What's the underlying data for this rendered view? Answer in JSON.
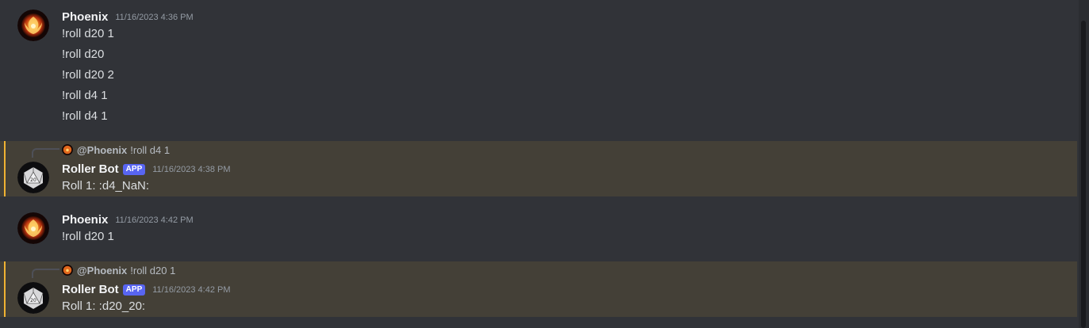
{
  "messages": [
    {
      "author": "Phoenix",
      "timestamp": "11/16/2023 4:36 PM",
      "lines": [
        "!roll d20 1",
        "!roll d20",
        "!roll d20 2",
        "!roll d4 1",
        "!roll d4 1"
      ]
    },
    {
      "reply": {
        "author": "@Phoenix",
        "text": "!roll d4 1"
      },
      "author": "Roller Bot",
      "badge": "APP",
      "timestamp": "11/16/2023 4:38 PM",
      "lines": [
        "Roll 1: :d4_NaN:"
      ]
    },
    {
      "author": "Phoenix",
      "timestamp": "11/16/2023 4:42 PM",
      "lines": [
        "!roll d20 1"
      ]
    },
    {
      "reply": {
        "author": "@Phoenix",
        "text": "!roll d20 1"
      },
      "author": "Roller Bot",
      "badge": "APP",
      "timestamp": "11/16/2023 4:42 PM",
      "lines": [
        "Roll 1: :d20_20:"
      ]
    }
  ],
  "icons": {
    "user_avatar": "phoenix-avatar-icon",
    "bot_avatar": "d20-die-avatar-icon"
  },
  "colors": {
    "background": "#313338",
    "mention_highlight": "#444037",
    "mention_bar": "#f0b232",
    "app_badge": "#5865f2"
  }
}
